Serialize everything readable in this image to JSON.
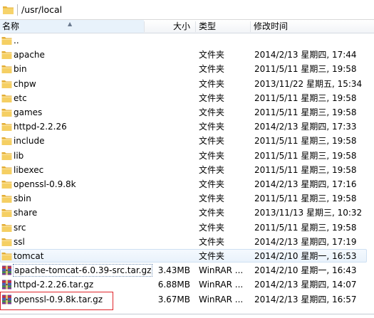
{
  "path": "/usr/local",
  "columns": {
    "name": "名称",
    "size": "大小",
    "type": "类型",
    "date": "修改时间"
  },
  "rows": [
    {
      "name": "..",
      "icon": "folder",
      "size": "",
      "type": "",
      "date": ""
    },
    {
      "name": "apache",
      "icon": "folder",
      "size": "",
      "type": "文件夹",
      "date": "2014/2/13 星期四, 17:44"
    },
    {
      "name": "bin",
      "icon": "folder",
      "size": "",
      "type": "文件夹",
      "date": "2011/5/11 星期三, 19:58"
    },
    {
      "name": "chpw",
      "icon": "folder",
      "size": "",
      "type": "文件夹",
      "date": "2013/11/22 星期五, 15:34"
    },
    {
      "name": "etc",
      "icon": "folder",
      "size": "",
      "type": "文件夹",
      "date": "2011/5/11 星期三, 19:58"
    },
    {
      "name": "games",
      "icon": "folder",
      "size": "",
      "type": "文件夹",
      "date": "2011/5/11 星期三, 19:58"
    },
    {
      "name": "httpd-2.2.26",
      "icon": "folder",
      "size": "",
      "type": "文件夹",
      "date": "2014/2/13 星期四, 17:33"
    },
    {
      "name": "include",
      "icon": "folder",
      "size": "",
      "type": "文件夹",
      "date": "2011/5/11 星期三, 19:58"
    },
    {
      "name": "lib",
      "icon": "folder",
      "size": "",
      "type": "文件夹",
      "date": "2011/5/11 星期三, 19:58"
    },
    {
      "name": "libexec",
      "icon": "folder",
      "size": "",
      "type": "文件夹",
      "date": "2011/5/11 星期三, 19:58"
    },
    {
      "name": "openssl-0.9.8k",
      "icon": "folder",
      "size": "",
      "type": "文件夹",
      "date": "2014/2/13 星期四, 17:16"
    },
    {
      "name": "sbin",
      "icon": "folder",
      "size": "",
      "type": "文件夹",
      "date": "2011/5/11 星期三, 19:58"
    },
    {
      "name": "share",
      "icon": "folder",
      "size": "",
      "type": "文件夹",
      "date": "2013/11/13 星期三, 10:32"
    },
    {
      "name": "src",
      "icon": "folder",
      "size": "",
      "type": "文件夹",
      "date": "2011/5/11 星期三, 19:58"
    },
    {
      "name": "ssl",
      "icon": "folder",
      "size": "",
      "type": "文件夹",
      "date": "2014/2/13 星期四, 17:19"
    },
    {
      "name": "tomcat",
      "icon": "folder",
      "size": "",
      "type": "文件夹",
      "date": "2014/2/10 星期一, 16:53"
    },
    {
      "name": "apache-tomcat-6.0.39-src.tar.gz",
      "icon": "winrar-archive",
      "size": "3.43MB",
      "type": "WinRAR ...",
      "date": "2014/2/10 星期一, 16:43"
    },
    {
      "name": "httpd-2.2.26.tar.gz",
      "icon": "winrar-archive",
      "size": "6.88MB",
      "type": "WinRAR ...",
      "date": "2014/2/13 星期四, 14:07"
    },
    {
      "name": "openssl-0.9.8k.tar.gz",
      "icon": "winrar-archive",
      "size": "3.67MB",
      "type": "WinRAR ...",
      "date": "2014/2/13 星期四, 16:57"
    }
  ],
  "colors": {
    "folder": "#f2c350",
    "header_sorted": "#e8f2fb",
    "highlight_box": "#e0252a"
  }
}
